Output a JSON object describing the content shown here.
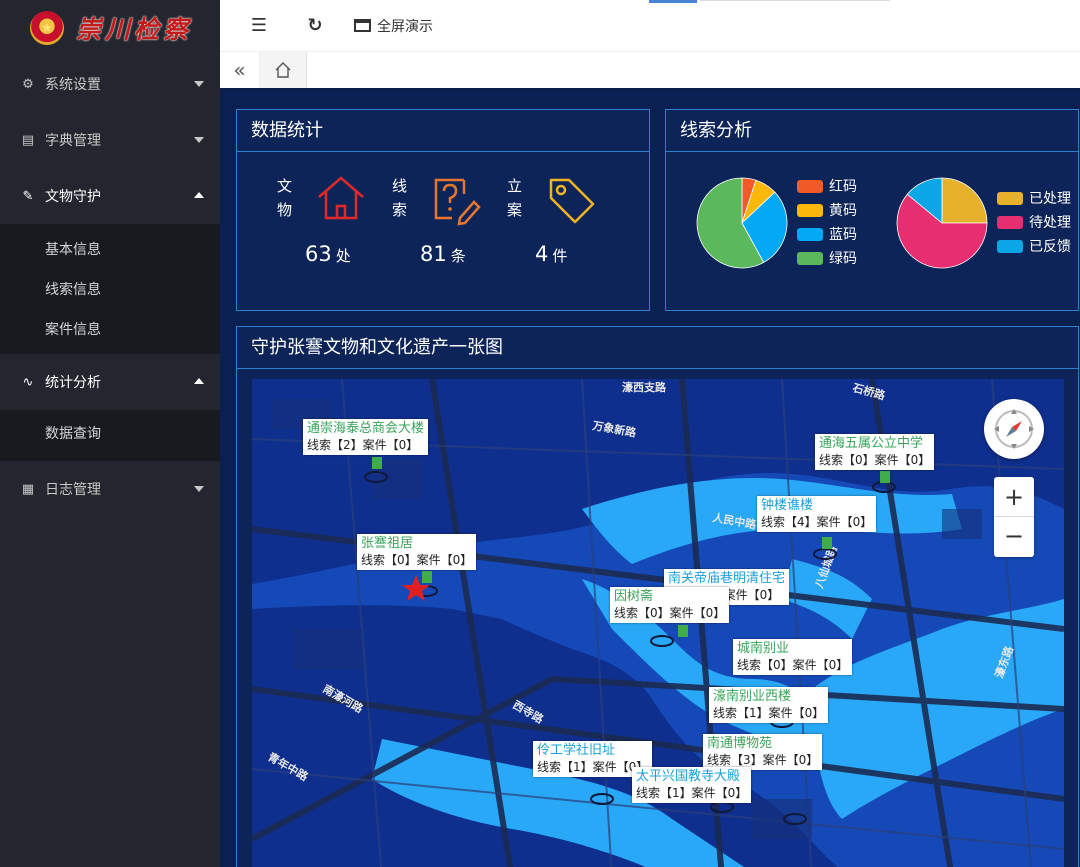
{
  "brand": {
    "title": "崇川检察"
  },
  "sidebar": {
    "items": [
      {
        "label": "系统设置",
        "icon": "gear-icon",
        "expanded": false
      },
      {
        "label": "字典管理",
        "icon": "document-icon",
        "expanded": false
      },
      {
        "label": "文物守护",
        "icon": "edit-icon",
        "expanded": true,
        "children": [
          "基本信息",
          "线索信息",
          "案件信息"
        ]
      },
      {
        "label": "统计分析",
        "icon": "pulse-icon",
        "expanded": true,
        "children": [
          "数据查询"
        ]
      },
      {
        "label": "日志管理",
        "icon": "table-icon",
        "expanded": false
      }
    ]
  },
  "topbar": {
    "fullscreen_label": "全屏演示"
  },
  "stats_panel": {
    "title": "数据统计",
    "items": [
      {
        "label": "文物",
        "value": "63",
        "unit": "处",
        "icon": "house-icon",
        "color": "#e02a2a"
      },
      {
        "label": "线索",
        "value": "81",
        "unit": "条",
        "icon": "question-edit-icon",
        "color": "#e8772e"
      },
      {
        "label": "立案",
        "value": "4",
        "unit": "件",
        "icon": "tag-icon",
        "color": "#f0b323"
      }
    ]
  },
  "clue_panel": {
    "title": "线索分析",
    "pie1": {
      "legend": [
        {
          "label": "红码",
          "color": "#f25a27",
          "value": 0.05
        },
        {
          "label": "黄码",
          "color": "#fbb80b",
          "value": 0.08
        },
        {
          "label": "蓝码",
          "color": "#03a9f4",
          "value": 0.29
        },
        {
          "label": "绿码",
          "color": "#5cb85c",
          "value": 0.58
        }
      ]
    },
    "pie2": {
      "legend": [
        {
          "label": "已处理",
          "color": "#e6b12b",
          "value": 0.25
        },
        {
          "label": "待处理",
          "color": "#e62e71",
          "value": 0.61
        },
        {
          "label": "已反馈",
          "color": "#0ba6e5",
          "value": 0.14
        }
      ]
    }
  },
  "map_panel": {
    "title": "守护张謇文物和文化遗产一张图",
    "road_labels": [
      "濠西支路",
      "万象新路",
      "石桥路",
      "人民中路",
      "八仙城路",
      "濠东路",
      "西寺路",
      "南濠河路",
      "青年中路"
    ],
    "pins": [
      {
        "name": "通崇海泰总商会大楼",
        "sub": "线索【2】案件【0】",
        "style": ""
      },
      {
        "name": "通海五属公立中学",
        "sub": "线索【0】案件【0】",
        "style": ""
      },
      {
        "name": "钟楼谯楼",
        "sub": "线索【4】案件【0】",
        "style": "blue"
      },
      {
        "name": "张謇祖居",
        "sub": "线索【0】案件【0】",
        "style": ""
      },
      {
        "name": "南关帝庙巷明清住宅",
        "sub": "线索【0】案件【0】",
        "style": "blue"
      },
      {
        "name": "因树斋",
        "sub": "线索【0】案件【0】",
        "style": ""
      },
      {
        "name": "城南别业",
        "sub": "线索【0】案件【0】",
        "style": ""
      },
      {
        "name": "濠南别业西楼",
        "sub": "线索【1】案件【0】",
        "style": ""
      },
      {
        "name": "南通博物苑",
        "sub": "线索【3】案件【0】",
        "style": ""
      },
      {
        "name": "伶工学社旧址",
        "sub": "线索【1】案件【0】",
        "style": "blue"
      },
      {
        "name": "太平兴国教寺大殿",
        "sub": "线索【1】案件【0】",
        "style": "blue"
      }
    ],
    "zoom_in": "+",
    "zoom_out": "−"
  }
}
